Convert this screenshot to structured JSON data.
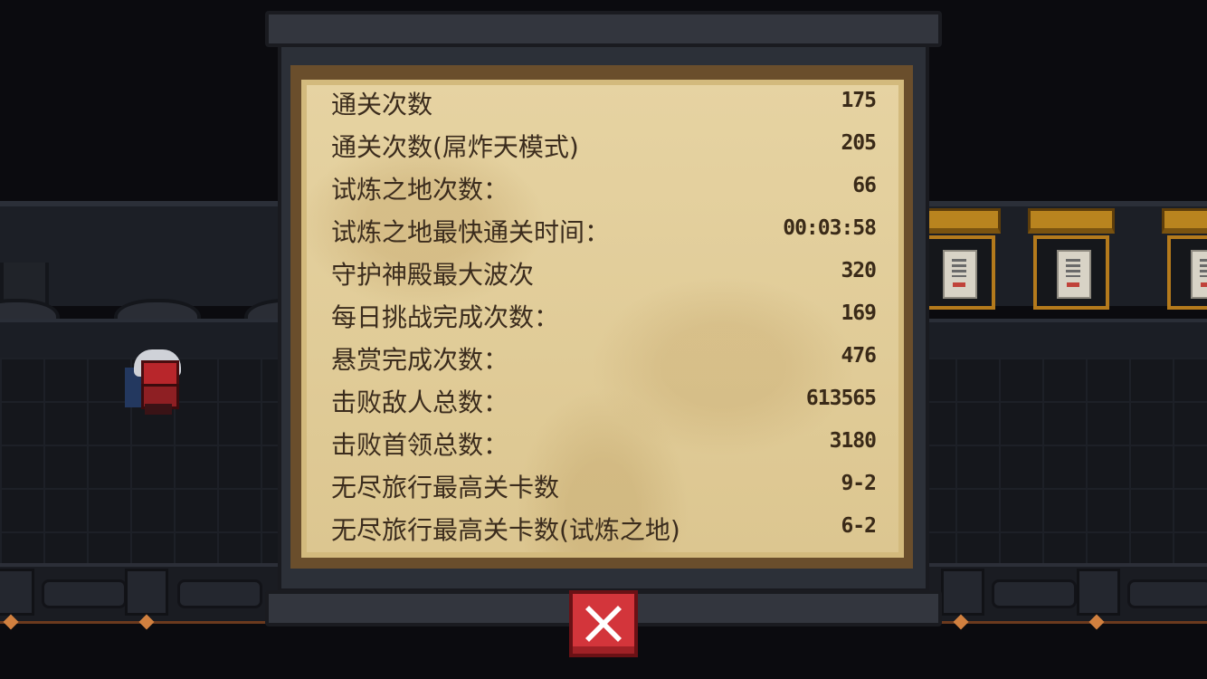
{
  "stats": [
    {
      "label": "通关次数",
      "value": "175"
    },
    {
      "label": "通关次数(屌炸天模式)",
      "value": "205"
    },
    {
      "label": "试炼之地次数：",
      "value": "66"
    },
    {
      "label": "试炼之地最快通关时间：",
      "value": "00:03:58"
    },
    {
      "label": "守护神殿最大波次",
      "value": "320"
    },
    {
      "label": "每日挑战完成次数：",
      "value": "169"
    },
    {
      "label": "悬赏完成次数：",
      "value": "476"
    },
    {
      "label": "击败敌人总数：",
      "value": "613565"
    },
    {
      "label": "击败首领总数：",
      "value": "3180"
    },
    {
      "label": "无尽旅行最高关卡数",
      "value": "9-2"
    },
    {
      "label": "无尽旅行最高关卡数(试炼之地)",
      "value": "6-2"
    }
  ],
  "close_button": {
    "icon": "close-icon",
    "color": "#d3353b"
  },
  "colors": {
    "parchment": "#e3cf9d",
    "text": "#3b2c1d",
    "frame": "#2c3038"
  }
}
